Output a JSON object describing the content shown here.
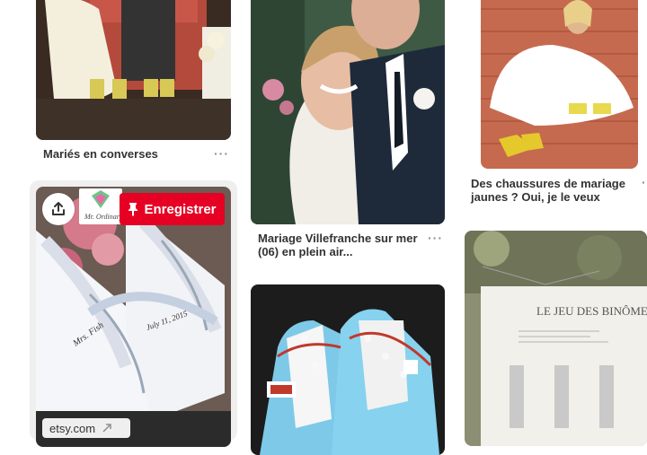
{
  "pins": [
    {
      "caption": "Mariés en converses"
    },
    {
      "caption_line1": "Mariage Villefranche sur mer",
      "caption_line2": "(06) en plein air..."
    },
    {
      "caption_line1": "Des chaussures de mariage",
      "caption_line2": "jaunes ? Oui, je le veux"
    },
    {
      "title_text": "LE JEU DES BINÔMES"
    }
  ],
  "hover_pin": {
    "save_label": "Enregistrer",
    "source_label": "etsy.com",
    "shoe_text_1": "Mrs. Fish",
    "shoe_text_2": "July 11, 2015",
    "logo_text": "Mr. Ordinary"
  },
  "more_label": "···",
  "colors": {
    "save": "#e60023",
    "caption": "#333333",
    "hover_bg": "#efefef"
  }
}
